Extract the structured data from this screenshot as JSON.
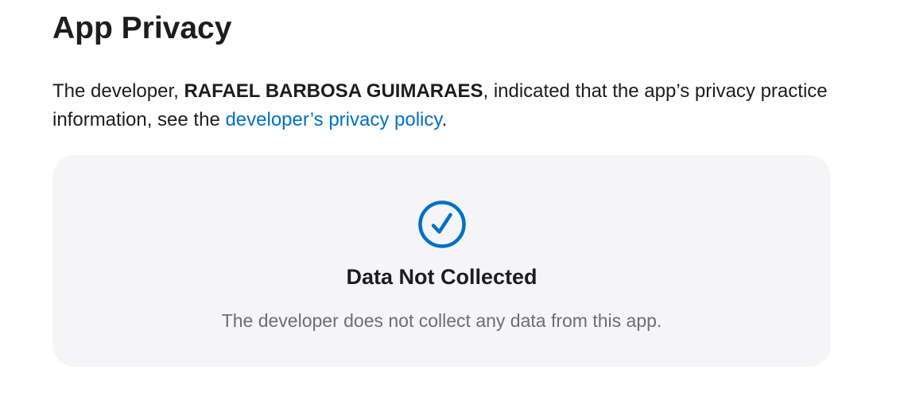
{
  "privacy": {
    "title": "App Privacy",
    "intro_prefix": "The developer, ",
    "developer_name": "RAFAEL BARBOSA GUIMARAES",
    "intro_middle": ", indicated that the app’s privacy practice",
    "intro_line2_prefix": "information, see the ",
    "policy_link_text": "developer’s privacy policy",
    "intro_line2_suffix": ".",
    "card": {
      "icon": "checkmark-circle-icon",
      "title": "Data Not Collected",
      "description": "The developer does not collect any data from this app."
    }
  },
  "colors": {
    "link": "#0070c9",
    "icon": "#0070c9",
    "card_background": "#f5f5f7",
    "secondary_text": "#6e6e73"
  }
}
